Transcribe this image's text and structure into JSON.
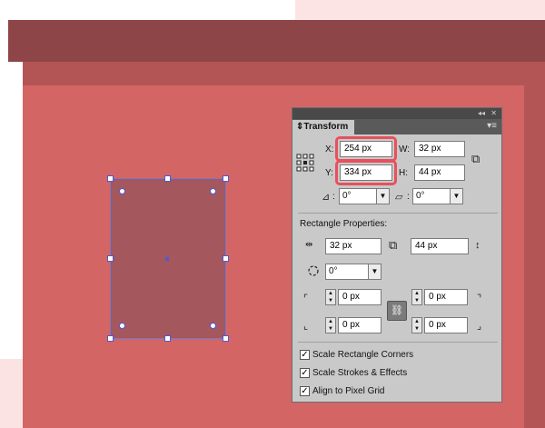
{
  "panel": {
    "title": "Transform",
    "x_label": "X:",
    "x_value": "254 px",
    "y_label": "Y:",
    "y_value": "334 px",
    "w_label": "W:",
    "w_value": "32 px",
    "h_label": "H:",
    "h_value": "44 px",
    "rotate_label": ":",
    "rotate_value": "0°",
    "shear_label": ":",
    "shear_value": "0°",
    "rect_props_label": "Rectangle Properties:",
    "rect_width": "32 px",
    "rect_height": "44 px",
    "rect_angle": "0°",
    "corner_tl": "0 px",
    "corner_tr": "0 px",
    "corner_bl": "0 px",
    "corner_br": "0 px",
    "scale_corners_label": "Scale Rectangle Corners",
    "scale_strokes_label": "Scale Strokes & Effects",
    "align_pixel_label": "Align to Pixel Grid",
    "check_mark": "✓"
  },
  "colors": {
    "highlight": "#e8505c",
    "selection": "#4d5bd6",
    "artboard": "#d46565"
  }
}
